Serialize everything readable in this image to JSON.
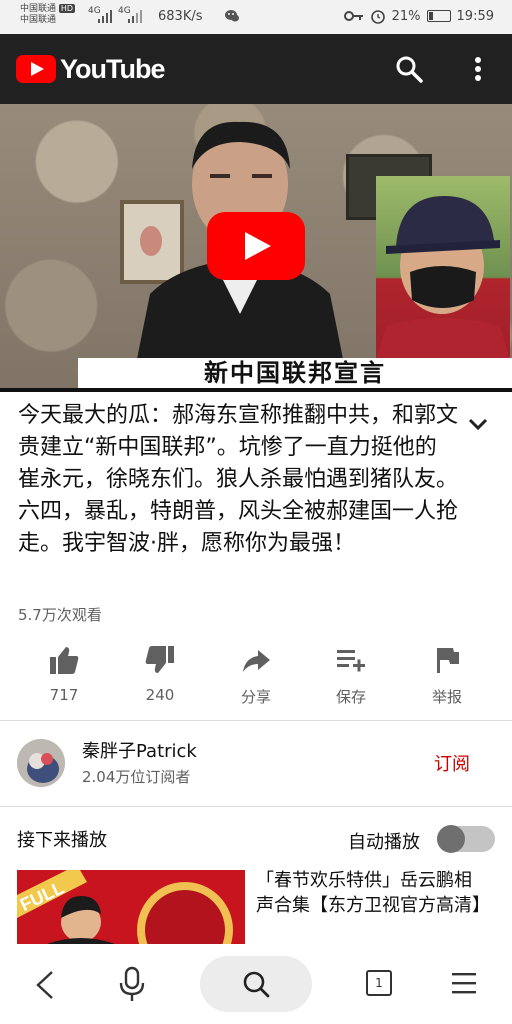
{
  "status_bar": {
    "carrier1": "中国联通",
    "carrier2": "中国联通",
    "hd_badge": "HD",
    "net1": "4G",
    "net2": "4G",
    "speed": "683K/s",
    "battery_percent": "21%",
    "battery_level": 0.21,
    "time": "19:59"
  },
  "app_bar": {
    "brand": "YouTube",
    "icons": [
      "search-icon",
      "more-vert-icon"
    ]
  },
  "video": {
    "caption": "新中国联邦宣言"
  },
  "title": "今天最大的瓜：郝海东宣称推翻中共，和郭文贵建立“新中国联邦”。坑惨了一直力挺他的崔永元，徐晓东们。狼人杀最怕遇到猪队友。六四，暴乱，特朗普，风头全被郝建国一人抢走。我宇智波·胖，愿称你为最强！",
  "views": "5.7万次观看",
  "actions": [
    {
      "icon": "thumb-up-icon",
      "label": "717"
    },
    {
      "icon": "thumb-down-icon",
      "label": "240"
    },
    {
      "icon": "share-icon",
      "label": "分享"
    },
    {
      "icon": "playlist-add-icon",
      "label": "保存"
    },
    {
      "icon": "flag-icon",
      "label": "举报"
    }
  ],
  "channel": {
    "name": "秦胖子Patrick",
    "subscribers": "2.04万位订阅者",
    "subscribe_label": "订阅"
  },
  "up_next": {
    "heading": "接下来播放",
    "autoplay_label": "自动播放",
    "autoplay_on": false,
    "item": {
      "title": "「春节欢乐特供」岳云鹏相声合集【东方卫视官方高清】",
      "thumb_badge": "FULL"
    }
  },
  "nav_bar": {
    "tab_count": "1",
    "icons": [
      "back-icon",
      "mic-icon",
      "search-icon",
      "tabs-icon",
      "menu-icon"
    ]
  }
}
